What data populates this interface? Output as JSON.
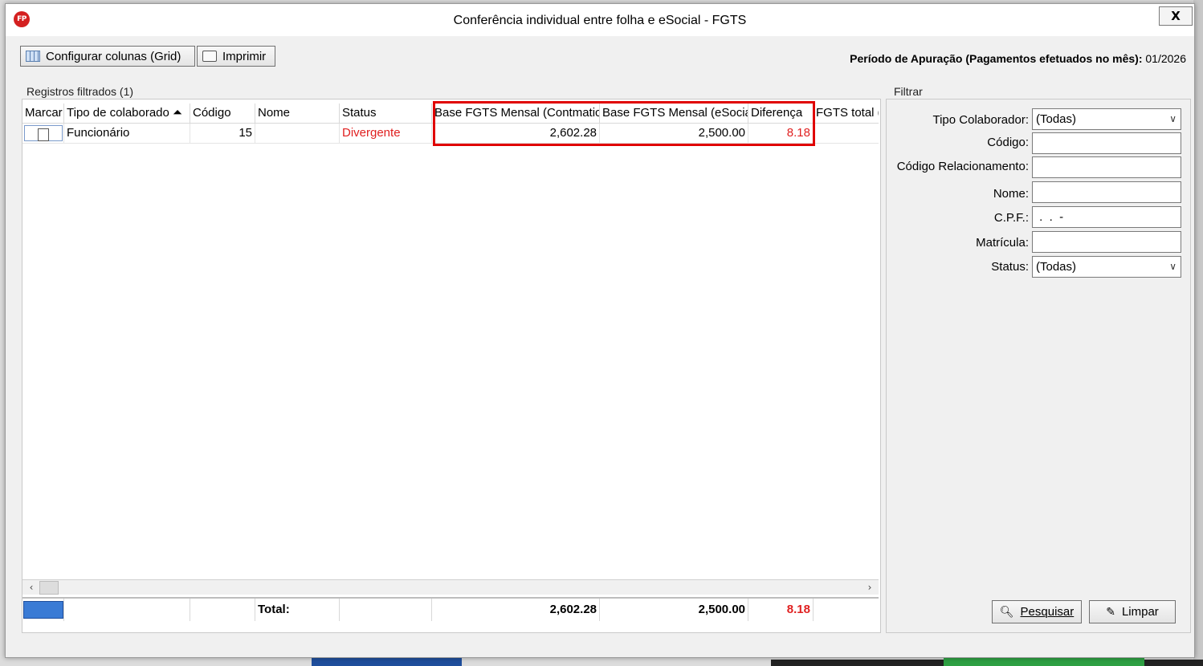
{
  "window": {
    "title": "Conferência individual entre folha e eSocial - FGTS",
    "app_icon": "FP",
    "close": "X"
  },
  "toolbar": {
    "config_label": "Configurar colunas (Grid)",
    "print_label": "Imprimir"
  },
  "periodo": {
    "label": "Período de Apuração (Pagamentos efetuados no mês):",
    "value": "01/2026"
  },
  "grid": {
    "group_title": "Registros filtrados (1)",
    "columns": [
      "Marcar",
      "Tipo de colaborado ⏶",
      "Código",
      "Nome",
      "Status",
      "Base FGTS Mensal (Contmatic)",
      "Base FGTS Mensal (eSocial)",
      "Diferença",
      "FGTS total ("
    ],
    "rows": [
      {
        "tipo": "Funcionário",
        "codigo": "15",
        "nome": "",
        "status": "Divergente",
        "base_contmatic": "2,602.28",
        "base_esocial": "2,500.00",
        "diferenca": "8.18"
      }
    ],
    "footer": {
      "label": "Total:",
      "base_contmatic": "2,602.28",
      "base_esocial": "2,500.00",
      "diferenca": "8.18"
    }
  },
  "filter": {
    "group_title": "Filtrar",
    "tipo_label": "Tipo Colaborador:",
    "tipo_value": "(Todas)",
    "codigo_label": "Código:",
    "codrel_label": "Código Relacionamento:",
    "nome_label": "Nome:",
    "cpf_label": "C.P.F.:",
    "cpf_mask": " .  .  -",
    "matricula_label": "Matrícula:",
    "status_label": "Status:",
    "status_value": "(Todas)",
    "pesquisar_label": "Pesquisar",
    "limpar_label": "Limpar"
  },
  "colors": {
    "highlight": "#e00000",
    "divergent": "#e02020",
    "accent": "#3a7bd5"
  },
  "icons": [
    "grid-icon",
    "printer-icon",
    "search-icon",
    "eraser-icon",
    "close-icon",
    "sort-asc-icon",
    "chevron-down-icon"
  ]
}
